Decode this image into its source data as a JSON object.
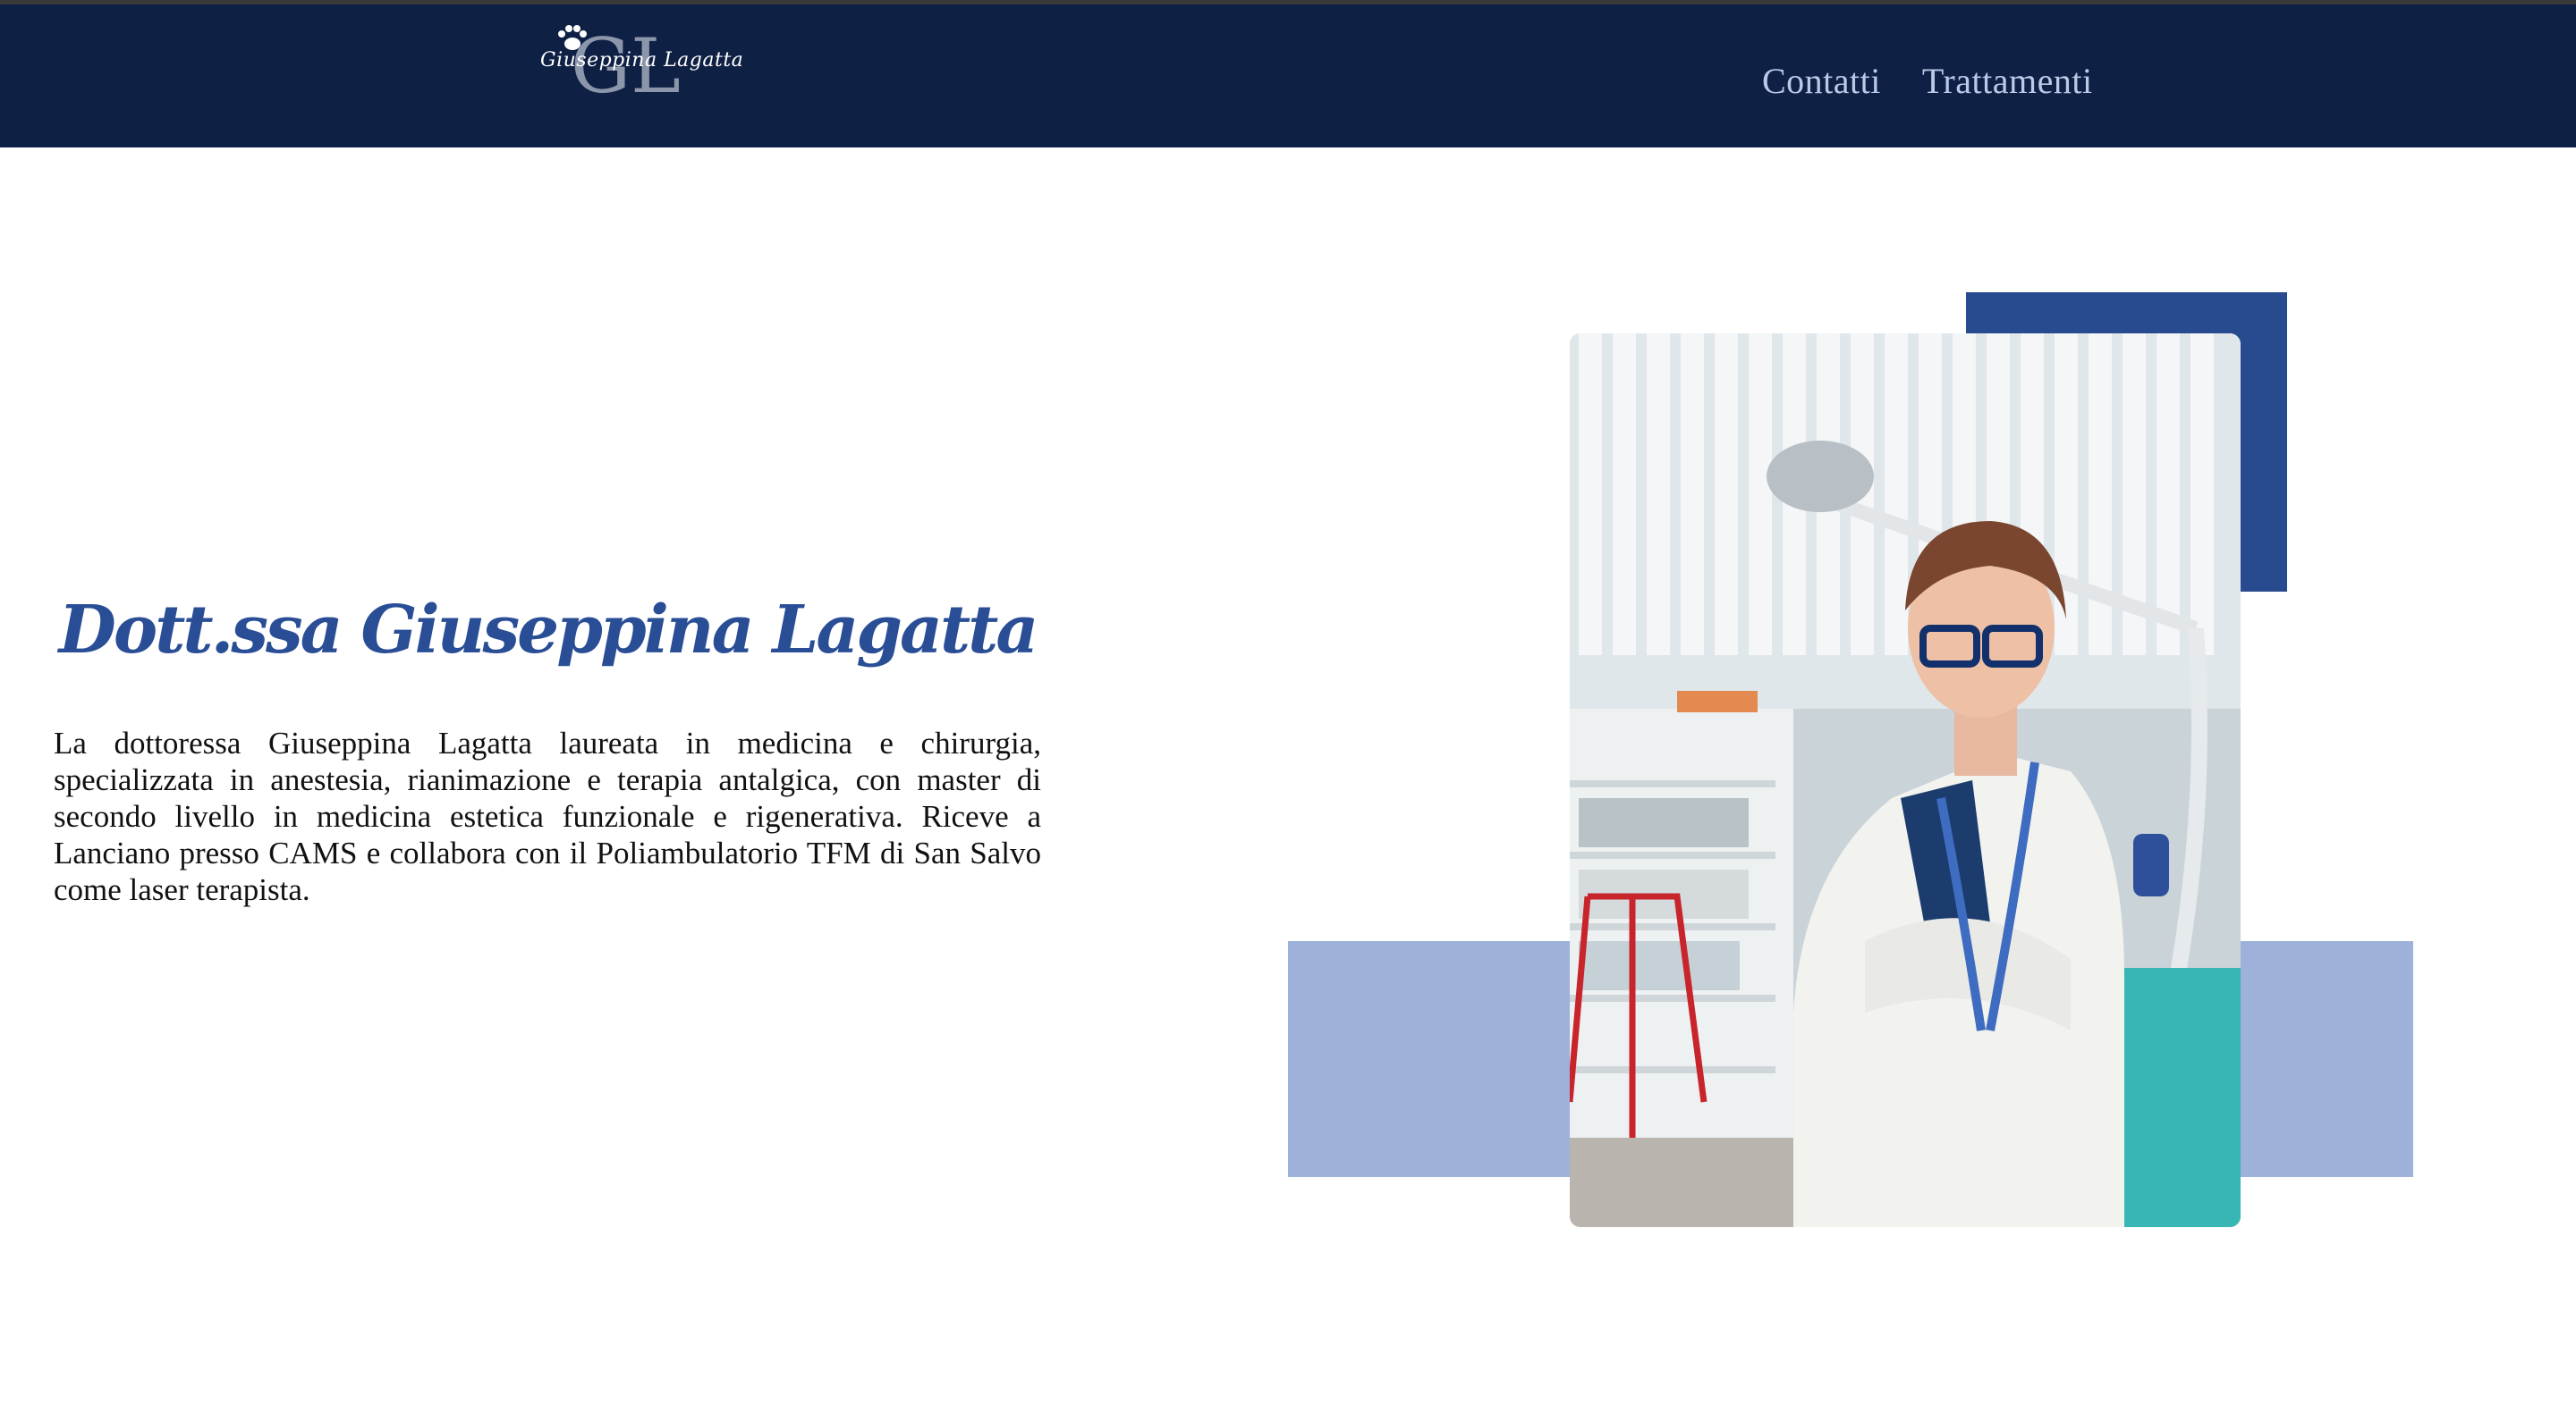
{
  "header": {
    "logo": {
      "monogram": "GL",
      "script_name": "Giuseppina Lagatta",
      "icon": "paw-icon"
    },
    "nav": [
      {
        "label": "Contatti"
      },
      {
        "label": "Trattamenti"
      }
    ]
  },
  "main": {
    "title": "Dott.ssa Giuseppina Lagatta",
    "bio": "La dottoressa Giuseppina Lagatta laureata in medicina e chirurgia, specializzata in anestesia, rianimazione e terapia antalgica, con master di secondo livello in medicina estetica funzionale e rigenerativa. Riceve a Lanciano presso CAMS e collabora con il Poliambulatorio TFM di San Salvo come laser terapista."
  },
  "colors": {
    "navbar": "#0f2045",
    "nav_text": "#b9c9e6",
    "heading": "#2a4e96",
    "accent_dark": "#284a8f",
    "accent_light": "#9db1db"
  }
}
